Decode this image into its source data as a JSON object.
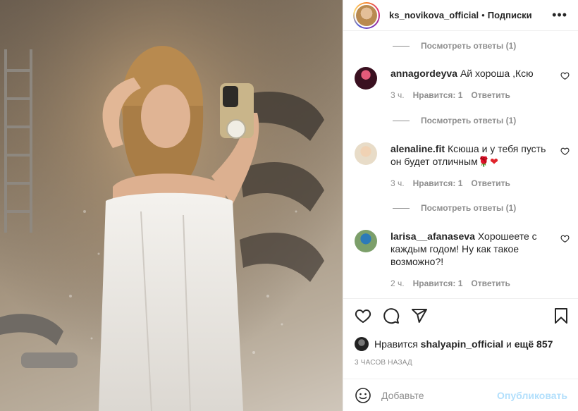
{
  "post": {
    "image_alt": "woman in white towel taking mirror selfie",
    "author": "ks_novikova_official",
    "dot": "•",
    "follow_label": "Подписки",
    "more_label": "•••"
  },
  "comments": {
    "view_replies_label": "Посмотреть ответы (1)",
    "items": [
      {
        "username": "annagordeyva",
        "text": "Ай хороша ,Ксю",
        "time": "3 ч.",
        "likes": "Нравится: 1",
        "reply": "Ответить"
      },
      {
        "username": "alenaline.fit",
        "text": "Ксюша и у тебя пусть он будет отличным",
        "emoji": "🌹❤",
        "time": "3 ч.",
        "likes": "Нравится: 1",
        "reply": "Ответить"
      },
      {
        "username": "larisa__afanaseva",
        "text": "Хорошеете с каждым годом! Ну как такое возможно?!",
        "time": "2 ч.",
        "likes": "Нравится: 1",
        "reply": "Ответить"
      }
    ]
  },
  "actions": {
    "icons": [
      "heart-icon",
      "comment-icon",
      "share-icon",
      "bookmark-icon"
    ]
  },
  "likes": {
    "prefix": "Нравится",
    "user": "shalyapin_official",
    "connector": "и",
    "rest": "ещё 857"
  },
  "timestamp": "3 ЧАСОВ НАЗАД",
  "composer": {
    "placeholder": "Добавьте",
    "post_label": "Опубликовать"
  },
  "colors": {
    "link_disabled": "#b2dffc",
    "secondary_text": "#8e8e8e",
    "border": "#efefef"
  }
}
